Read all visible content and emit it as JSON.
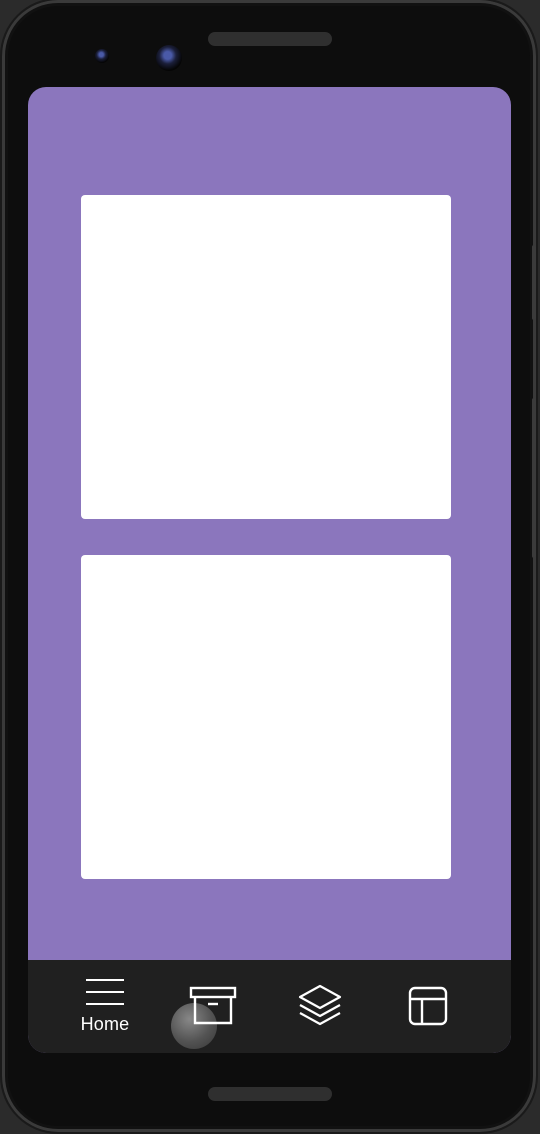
{
  "nav": {
    "items": [
      {
        "id": "home",
        "label": "Home",
        "icon": "menu-icon",
        "active": true
      },
      {
        "id": "archive",
        "label": "",
        "icon": "archive-icon",
        "active": false
      },
      {
        "id": "layers",
        "label": "",
        "icon": "layers-icon",
        "active": false
      },
      {
        "id": "layout",
        "label": "",
        "icon": "layout-icon",
        "active": false
      }
    ]
  },
  "colors": {
    "screen_background": "#8b76bd",
    "card_background": "#ffffff",
    "nav_background": "#202020",
    "nav_foreground": "#ffffff"
  }
}
